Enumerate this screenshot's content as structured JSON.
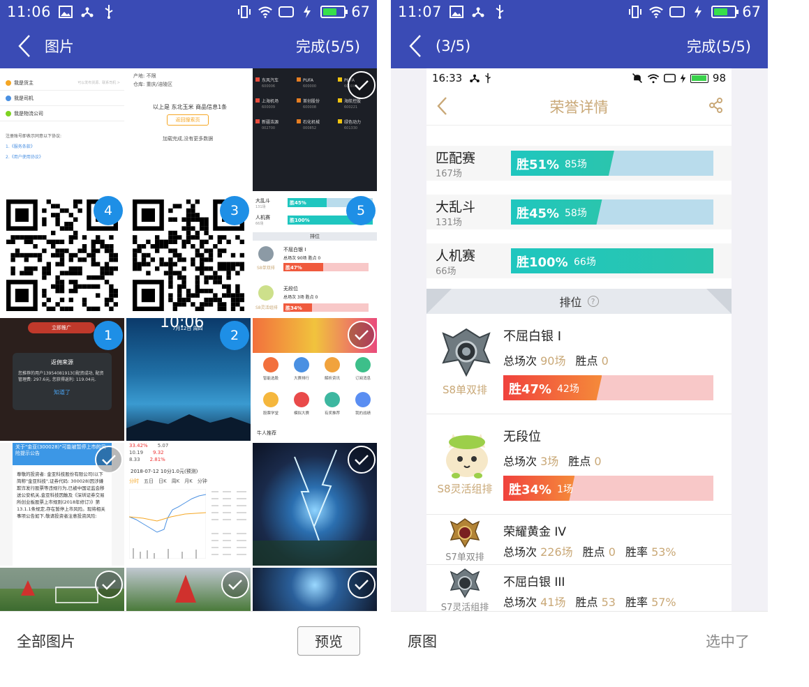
{
  "colors": {
    "primary": "#3a4bb5",
    "badge_blue": "#1e8fe6",
    "win_teal": "#1fc6bf",
    "win_red": "#f0423d",
    "gold_text": "#c9a877"
  },
  "left": {
    "status": {
      "time": "11:06",
      "battery": "67"
    },
    "title": "图片",
    "done": "完成(5/5)",
    "bottom": {
      "all_images": "全部图片",
      "preview": "预览"
    },
    "badges": [
      "4",
      "3",
      "5",
      "1",
      "2"
    ],
    "thumbs": {
      "roles": [
        "我是货主",
        "我是司机",
        "我是物流公司"
      ],
      "roles_hint": "可以发布货源、联系司机 >",
      "register_note": "注册账号即表示同意以下协议:",
      "agreements": [
        "1.《服务条款》",
        "2.《用户使用协议》"
      ],
      "search_result": "以上是 东北玉米 商品信息1条",
      "search_btn": "返回搜索页",
      "loaded": "加载完成,没有更多数据",
      "origin": "产地: 不限",
      "warehouse": "仓库: 重庆/涪陵区",
      "stocks": [
        [
          "东风汽车",
          "600006"
        ],
        [
          "PUFA",
          "600000"
        ],
        [
          "PUFA",
          "600000"
        ],
        [
          "上海机场",
          "600009"
        ],
        [
          "首创股份",
          "600008"
        ],
        [
          "海航控股",
          "600221"
        ],
        [
          "新疆浩源",
          "002700"
        ],
        [
          "石化机械",
          "000852"
        ],
        [
          "绿色动力",
          "601330"
        ]
      ],
      "mini_modes": [
        {
          "name": "大乱斗",
          "count": "131场",
          "bar": "胜45%",
          "games": "58场"
        },
        {
          "name": "人机赛",
          "count": "66场",
          "bar": "胜100%",
          "games": "66场"
        }
      ],
      "mini_rank": "排位",
      "mini_ranks": [
        {
          "title": "不屈白银 I",
          "label": "S8单双排",
          "stats": "总场次 90场  胜点 0",
          "bar": "胜47%",
          "games": "42场"
        },
        {
          "title": "无段位",
          "label": "S8灵活组排",
          "stats": "总场次 3场  胜点 0",
          "bar": "胜34%",
          "games": "1场"
        }
      ],
      "dialog_title": "返佣来源",
      "dialog_text": "您推荐的用户13954081913()配资成功, 配资管理费: 297.6元, 您获得返利: 119.04元.",
      "dialog_btn": "知道了",
      "promo": "立即推广",
      "lock_time": "10:06",
      "lock_date": "7月12日 周四",
      "app_icons": [
        "智能选股",
        "大赛排行",
        "解析资讯",
        "订阅消息",
        "股票学堂",
        "模拟大赛",
        "有奖推荐",
        "我的战绩"
      ],
      "recommend": "牛人推荐",
      "notice_title": "关于\"金亚(300028)\"可能被暂停上市的风险提示公告",
      "notice_body": "尊敬的投资者: 金亚科技股份有限公司(以下简称\"金亚科技\",证券代码: 300028)因涉嫌欺诈发行股票等违规行为,已被中国证监会移送公安机关,金亚科技因触及《深圳证券交易所创业板股票上市规则(2018年修订)》第13.1.1条规定,存在暂停上市风险。现将相关事项公告如下,敬请投资者注意投资风险:",
      "chart_header": "2018-07-12  10分1.0元(预测)",
      "chart_tabs": [
        "分时",
        "五日",
        "日K",
        "周K",
        "月K",
        "分钟"
      ],
      "quote": [
        "33.42%",
        "5.07",
        "10.19",
        "9.32",
        "8.33",
        "2.81%"
      ]
    }
  },
  "right": {
    "status": {
      "time": "11:07",
      "battery": "67"
    },
    "title": "(3/5)",
    "done": "完成(5/5)",
    "bottom": {
      "original": "原图",
      "selected": "选中了"
    },
    "preview": {
      "status": {
        "time": "16:33",
        "battery": "98"
      },
      "title": "荣誉详情",
      "modes": [
        {
          "name": "匹配赛",
          "count": "167场",
          "win_pct": "胜51%",
          "win_fraction": 0.51,
          "games": "85场"
        },
        {
          "name": "大乱斗",
          "count": "131场",
          "win_pct": "胜45%",
          "win_fraction": 0.45,
          "games": "58场"
        },
        {
          "name": "人机赛",
          "count": "66场",
          "win_pct": "胜100%",
          "win_fraction": 1.0,
          "games": "66场"
        }
      ],
      "rank_header": "排位",
      "ranks": [
        {
          "title": "不屈白银 I",
          "label": "S8单双排",
          "stats": {
            "total_label": "总场次",
            "total": "90场",
            "points_label": "胜点",
            "points": "0"
          },
          "win_pct": "胜47%",
          "win_fraction": 0.47,
          "games": "42场"
        },
        {
          "title": "无段位",
          "label": "S8灵活组排",
          "stats": {
            "total_label": "总场次",
            "total": "3场",
            "points_label": "胜点",
            "points": "0"
          },
          "win_pct": "胜34%",
          "win_fraction": 0.34,
          "games": "1场"
        }
      ],
      "ranks_small": [
        {
          "title": "荣耀黄金 IV",
          "label": "S7单双排",
          "total_label": "总场次",
          "total": "226场",
          "points_label": "胜点",
          "points": "0",
          "rate_label": "胜率",
          "rate": "53%"
        },
        {
          "title": "不屈白银 III",
          "label": "S7灵活组排",
          "total_label": "总场次",
          "total": "41场",
          "points_label": "胜点",
          "points": "53",
          "rate_label": "胜率",
          "rate": "57%"
        }
      ]
    }
  }
}
